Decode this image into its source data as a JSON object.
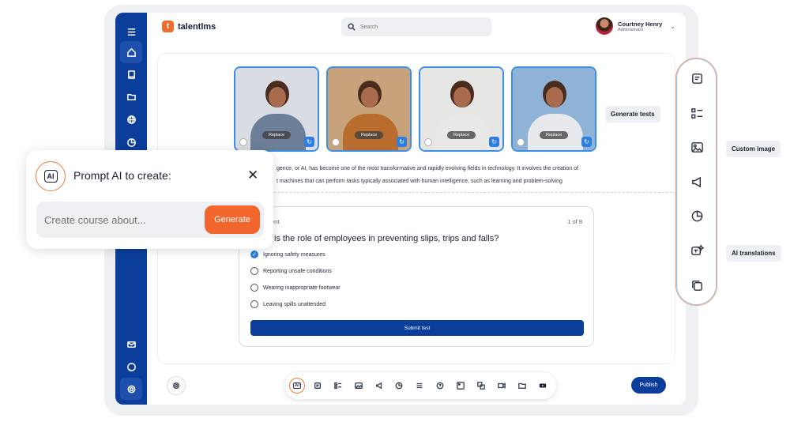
{
  "app": {
    "logo_text": "talentlms",
    "logo_letter": "t",
    "search_placeholder": "Search",
    "user_name": "Courtney Henry",
    "user_role": "Administrator"
  },
  "sidebar": {
    "items": [
      "home-icon",
      "book-icon",
      "folder-icon",
      "globe-icon",
      "chart-icon",
      "mail-icon",
      "chat-icon",
      "gear-icon"
    ]
  },
  "images": {
    "replace_label": "Replace",
    "cards": [
      {
        "bg": "#d9dde3",
        "torso": "#6d7f98"
      },
      {
        "bg": "#c7a27a",
        "torso": "#b86c2e"
      },
      {
        "bg": "#e6e6e4",
        "torso": "#e8e8e6"
      },
      {
        "bg": "#8fb3d6",
        "torso": "#e7e9ec"
      }
    ]
  },
  "body": {
    "line1": "gence, or AI, has become one of the most transformative and rapidly evolving fields in technology. It involves the creation of",
    "line2": "t machines that can perform tasks typically associated with human intelligence, such as learning and problem-solving"
  },
  "quiz": {
    "label": "ent",
    "count": "1 of 8",
    "question": "is the role of employees in preventing slips, trips and falls?",
    "options": [
      {
        "label": "Ignoring safety measures",
        "checked": true
      },
      {
        "label": "Reporting unsafe conditions",
        "checked": false
      },
      {
        "label": "Wearing inappropriate footwear",
        "checked": false
      },
      {
        "label": "Leaving spills unattended",
        "checked": false
      }
    ],
    "submit_label": "Submit test"
  },
  "toolbar": {
    "ai_label": "AI",
    "items": [
      "ai-icon",
      "text-block-icon",
      "list-icon",
      "image-icon",
      "megaphone-icon",
      "pie-chart-icon",
      "lines-icon",
      "help-icon",
      "picture-icon",
      "translate-icon",
      "video-icon",
      "folder-icon",
      "youtube-icon"
    ],
    "publish_label": "Publish"
  },
  "right_panel": {
    "items": [
      "text-block-icon",
      "checklist-icon",
      "image-icon",
      "megaphone-icon",
      "pie-chart-icon",
      "ai-translate-icon",
      "copy-icon"
    ],
    "tooltips": {
      "generate_tests": "Generate tests",
      "custom_image": "Custom image",
      "ai_translations": "AI translations"
    }
  },
  "prompt": {
    "ai_badge": "AI",
    "title": "Prompt AI to create:",
    "close": "✕",
    "input_placeholder": "Create course about...",
    "generate_label": "Generate"
  },
  "colors": {
    "brand_blue": "#0b3d9a",
    "accent_orange": "#f2652d",
    "selection_blue": "#2f7fe0"
  }
}
